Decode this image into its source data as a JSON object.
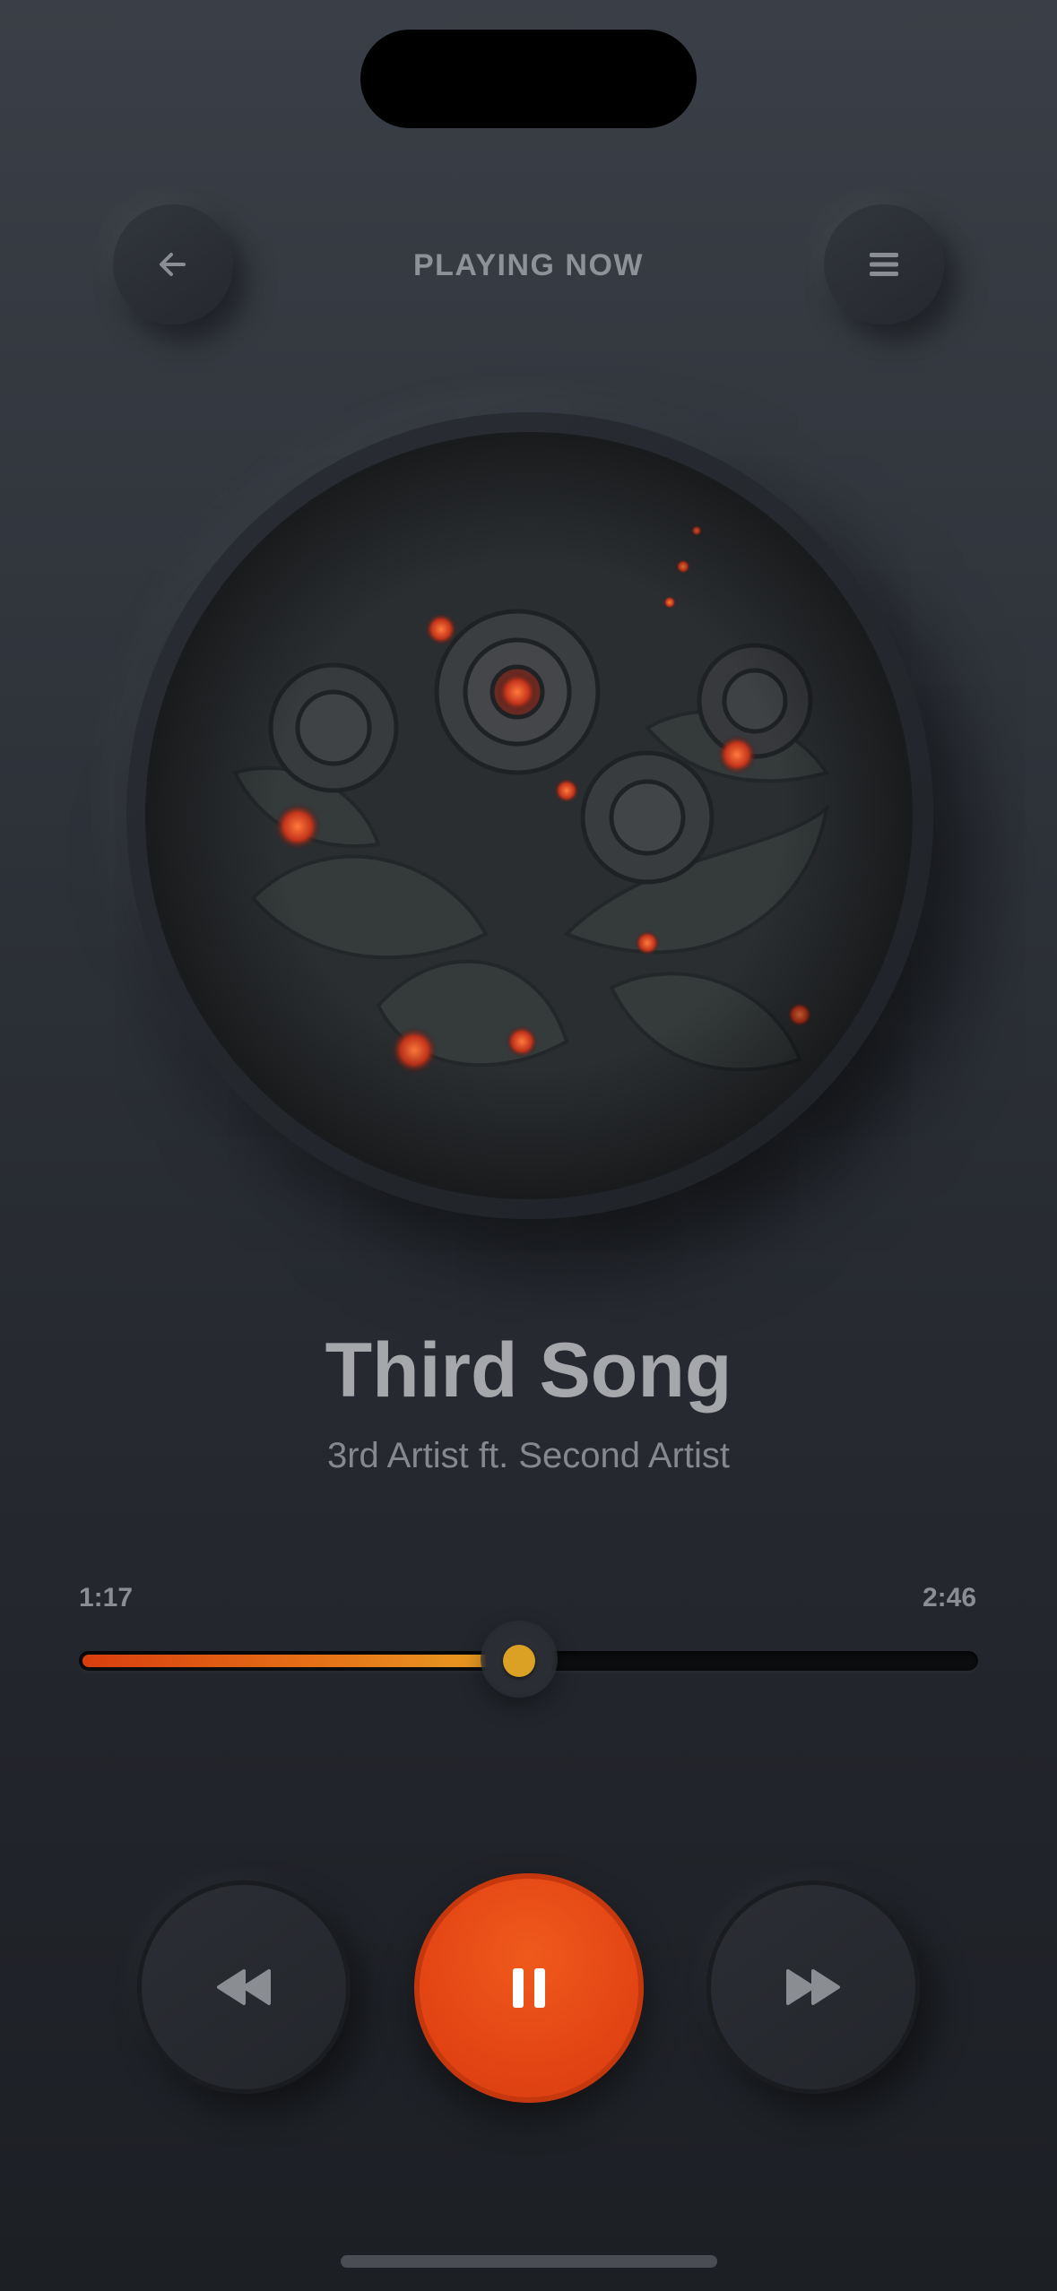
{
  "header": {
    "title": "PLAYING NOW",
    "back_icon": "arrow-left-icon",
    "menu_icon": "hamburger-menu-icon"
  },
  "album_art": {
    "description_icon": "album-cover-image"
  },
  "song": {
    "title": "Third Song",
    "artist": "3rd Artist ft. Second Artist"
  },
  "progress": {
    "elapsed": "1:17",
    "total": "2:46",
    "fraction": 0.4891
  },
  "controls": {
    "prev_icon": "rewind-icon",
    "play_icon": "pause-icon",
    "next_icon": "fast-forward-icon"
  },
  "colors": {
    "accent": "#e44514",
    "progress_start": "#d83e0e",
    "progress_end": "#e8a224",
    "knob": "#dba124",
    "background": "#2c3037"
  }
}
